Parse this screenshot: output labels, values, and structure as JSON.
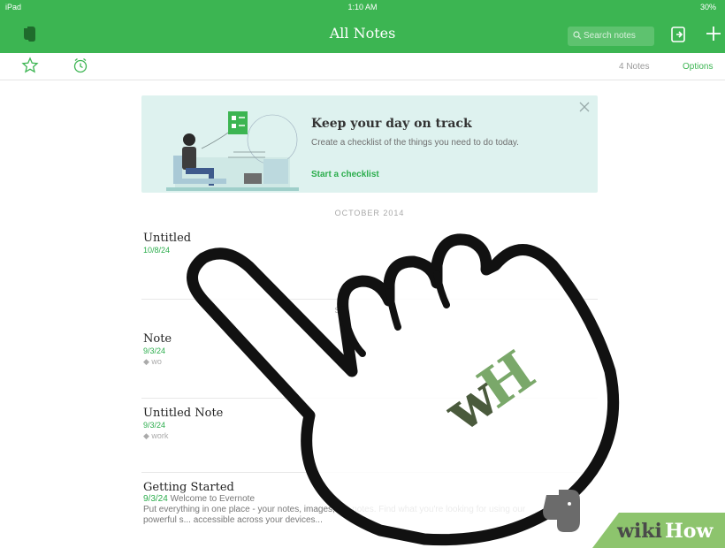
{
  "status_bar": {
    "device": "iPad",
    "time": "1:10 AM",
    "battery": "30%"
  },
  "nav": {
    "title": "All Notes",
    "search_placeholder": "Search notes"
  },
  "toolbar": {
    "note_count": "4 Notes",
    "options": "Options"
  },
  "banner": {
    "title": "Keep your day on track",
    "description": "Create a checklist of the things you need to do today.",
    "cta": "Start a checklist"
  },
  "sections": [
    {
      "header": "OCTOBER 2014"
    },
    {
      "header": "S"
    }
  ],
  "notes": [
    {
      "title": "Untitled",
      "date": "10/8/24"
    },
    {
      "title": "Note",
      "date": "9/3/24",
      "tag": "wo"
    },
    {
      "title": "Untitled Note",
      "date": "9/3/24",
      "tag": "work"
    },
    {
      "title": "Getting Started",
      "date": "9/3/24",
      "snippet_first": "Welcome to Evernote",
      "snippet_rest": "Put everything in one place - your notes, images, d...  notes. Find what you're looking for using our powerful s...  accessible across your devices..."
    }
  ],
  "watermark": {
    "wiki": "wiki",
    "how": "How",
    "badge": "wH"
  },
  "colors": {
    "brand_green": "#3cb552",
    "banner_bg": "#def2ef",
    "accent_green": "#2bad4c"
  },
  "icons": [
    "evernote-logo-icon",
    "search-icon",
    "new-note-icon",
    "plus-icon",
    "star-icon",
    "reminder-icon",
    "close-icon",
    "elephant-icon"
  ]
}
